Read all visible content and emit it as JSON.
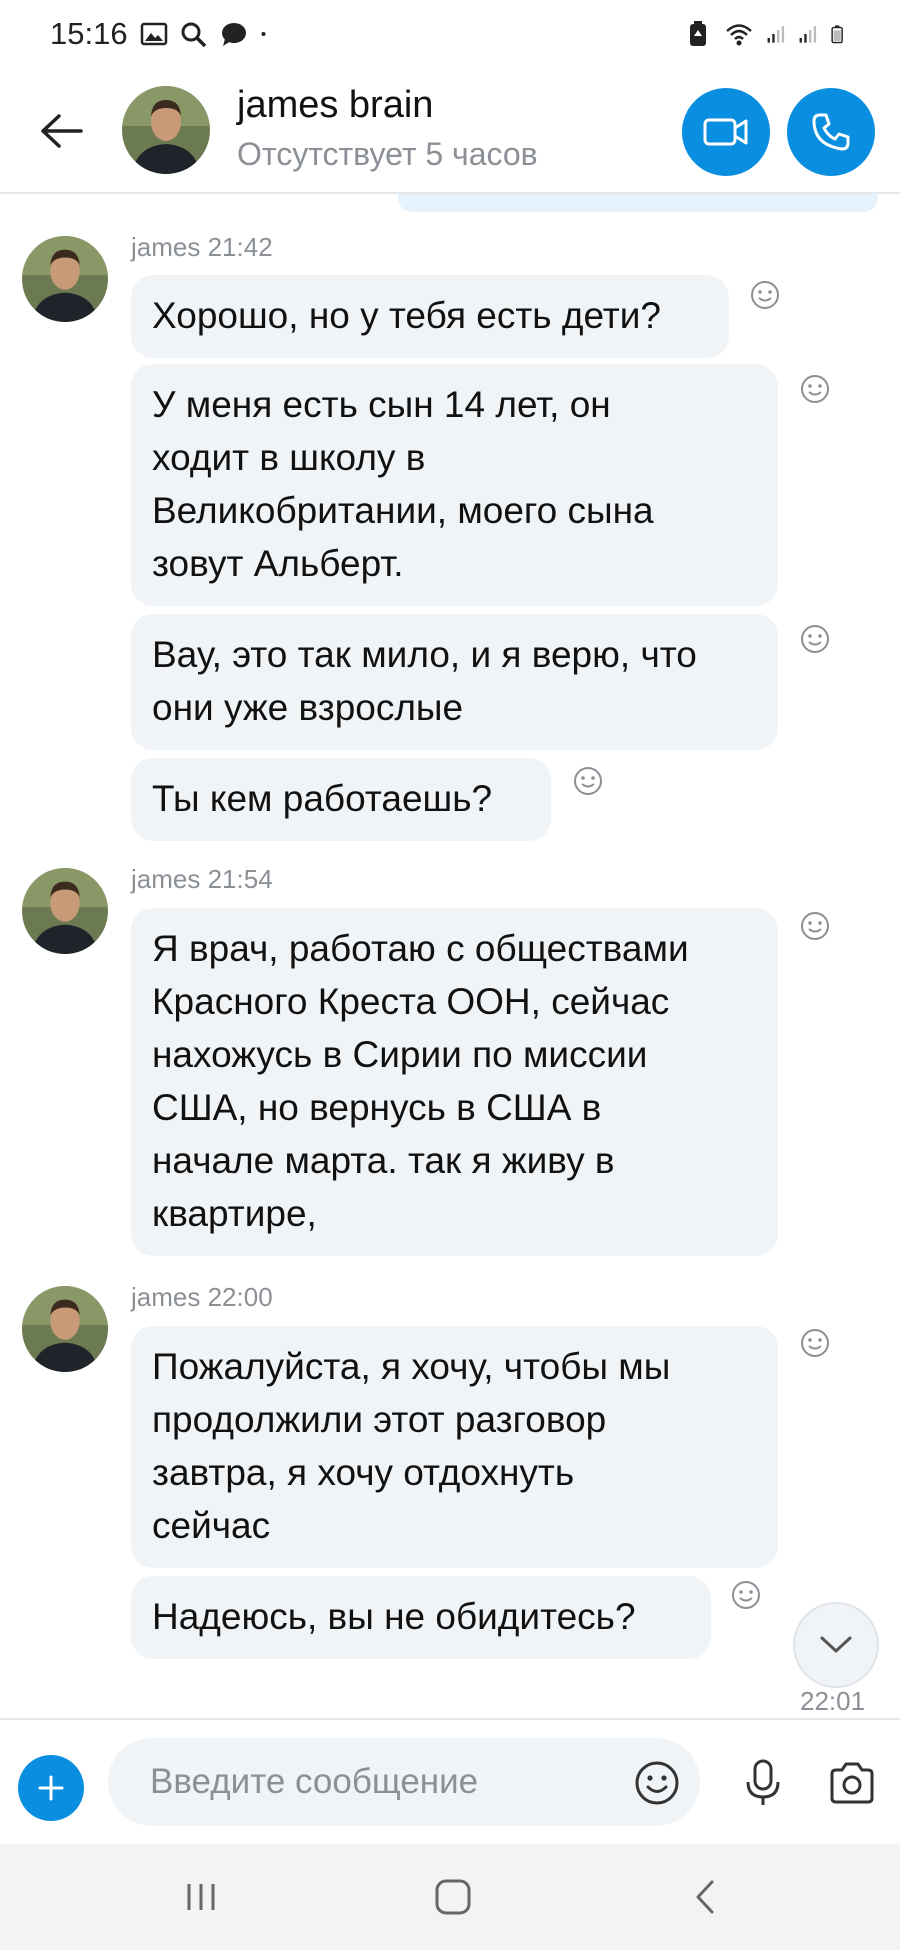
{
  "status_bar": {
    "time": "15:16",
    "icons": [
      "image-icon",
      "search-icon",
      "chat-icon",
      "dot-icon",
      "battery-saver-icon",
      "wifi-icon",
      "signal-icon",
      "signal-icon",
      "battery-icon"
    ]
  },
  "header": {
    "contact_name": "james brain",
    "presence": "Отсутствует 5 часов"
  },
  "messages": [
    {
      "sender": "james",
      "time": "21:42",
      "bubbles": [
        "Хорошо, но у тебя есть дети?",
        "У меня есть сын 14 лет, он\nходит в школу в\nВеликобритании, моего сына\nзовут Альберт.",
        "Вау, это так мило, и я верю, что\nони уже взрослые",
        "Ты кем работаешь?"
      ]
    },
    {
      "sender": "james",
      "time": "21:54",
      "bubbles": [
        "Я врач, работаю с обществами\nКрасного Креста ООН, сейчас\nнахожусь в Сирии по миссии\nСША, но вернусь в США в\nначале марта. так я живу в\nквартире,"
      ]
    },
    {
      "sender": "james",
      "time": "22:00",
      "bubbles": [
        "Пожалуйста, я хочу, чтобы мы\nпродолжили этот разговор\nзавтра, я хочу отдохнуть\nсейчас",
        "Надеюсь, вы не обидитесь?"
      ]
    }
  ],
  "last_message_time": "22:01",
  "composer": {
    "placeholder": "Введите сообщение"
  },
  "colors": {
    "accent": "#0a8ee0",
    "bubble_bg": "#f1f4f7",
    "meta_text": "#8b9096"
  }
}
